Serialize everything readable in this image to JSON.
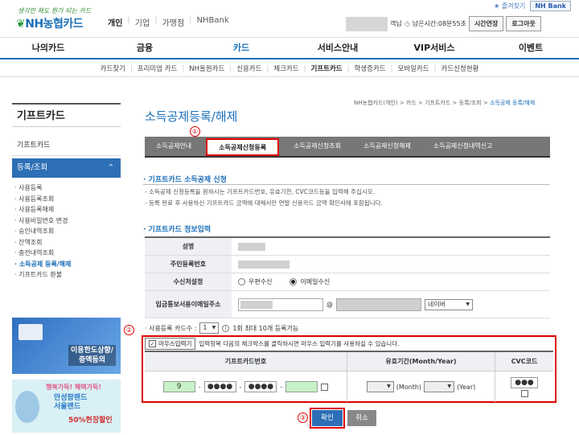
{
  "util": {
    "favorite": "즐겨찾기",
    "nhbank": "NH Bank"
  },
  "logo": {
    "slogan": "생각만 해도 뭔가 되는 카드",
    "brand": "NH농협카드"
  },
  "top_links": [
    "개인",
    "기업",
    "가맹점",
    "NHBank"
  ],
  "userbar": {
    "suffix": "객님",
    "session": "남은시간:08분55초",
    "extend": "시간연장",
    "logout": "로그아웃"
  },
  "gnb": [
    "나의카드",
    "금융",
    "카드",
    "서비스안내",
    "VIP서비스",
    "이벤트"
  ],
  "subnav": [
    "카드찾기",
    "프리미엄 카드",
    "NH올원카드",
    "신용카드",
    "체크카드",
    "기프트카드",
    "학생증카드",
    "모바일카드",
    "카드신청현황"
  ],
  "lnb": {
    "title": "기프트카드",
    "item1": "기프트카드",
    "active": "등록/조회",
    "active_arrow": "⌃",
    "subitems": [
      "· 사용등록",
      "· 사용등록조회",
      "· 사용등록해제",
      "· 사용비밀번호 변경",
      "· 승인내역조회",
      "· 잔액조회",
      "· 충전내역조회",
      "· 소득공제 등록/해제",
      "· 기프트카드 환불"
    ]
  },
  "banner1": {
    "text1": "이용한도상향/",
    "text2": "증액등의"
  },
  "banner2": {
    "l1": "행복가득! 혜택가득!",
    "l2a": "안성팜랜드",
    "l2b": "서울랜드",
    "l3": "50%현장할인"
  },
  "breadcrumb": {
    "path": "NH농협카드(개인) > 카드 > 기프트카드 > 등록/조회 > ",
    "current": "소득공제 등록/해제"
  },
  "page_title": "소득공제등록/해제",
  "annotations": [
    "①",
    "②",
    "③"
  ],
  "tabs": [
    "소득공제안내",
    "소득공제신청등록",
    "소득공제신청조회",
    "소득공제신청해제",
    "소득공제신청내역신고"
  ],
  "section1": {
    "title": "· 기프트카드 소득공제 신청",
    "lines": [
      "- 소득공제 신청등록을 원하시는 기프트카드번호, 유효기한, CVC코드등을 입력해 주십시오.",
      "- 등록 완료 후 사용하신 기프트카드 금액에 대해서만 연말 신용카드 금액 확인서에 포함됩니다."
    ]
  },
  "section2": {
    "title": "· 기프트카드 정보입력"
  },
  "form": {
    "name_label": "성명",
    "rrn_label": "주민등록번호",
    "recv_label": "수신처설정",
    "recv_opt1": "우편수신",
    "recv_opt2": "이메일수신",
    "email_label_1": "입금통보서용이메일",
    "email_label_2": "주소",
    "email_at": "@",
    "email_domain": "네이버"
  },
  "count": {
    "label": "· 사용등록 카드수 :",
    "value": "1",
    "note": "1회 최대 10개 등록가능"
  },
  "mouse": {
    "button": "마우스입력기",
    "desc": "입력항목 다음의 체크박스를 클릭하시면 마우스 입력기를 사용하실 수 있습니다."
  },
  "card_table": {
    "headers": [
      "기프트카드번호",
      "유효기간(Month/Year)",
      "CVC코드"
    ],
    "num1": "9",
    "num2": "●●●●",
    "num3": "●●●●",
    "num4": "",
    "dash": "-",
    "month_label": "(Month)",
    "year_label": "(Year)",
    "cvc": "●●●"
  },
  "buttons": {
    "ok": "확인",
    "cancel": "취소"
  }
}
